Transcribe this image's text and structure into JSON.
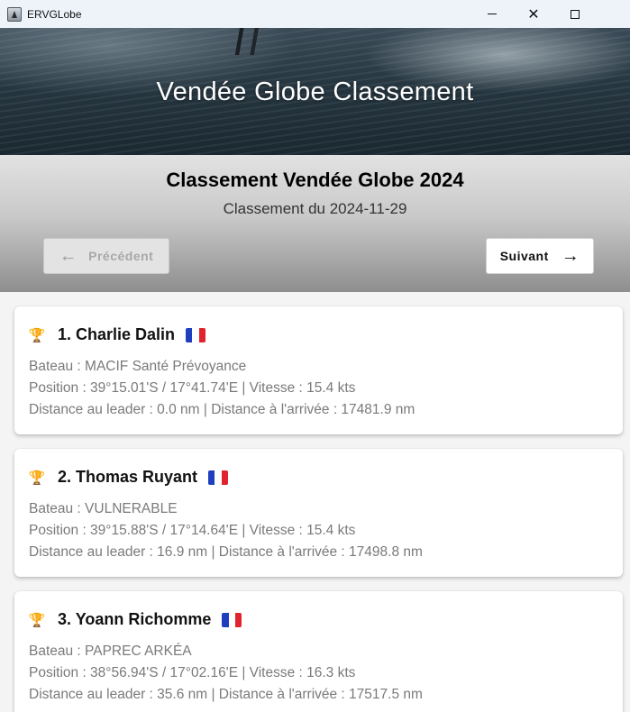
{
  "window": {
    "title": "ERVGLobe"
  },
  "hero": {
    "title": "Vendée Globe Classement"
  },
  "header": {
    "title": "Classement Vendée Globe 2024",
    "subtitle": "Classement du 2024-11-29",
    "prev_label": "Précédent",
    "next_label": "Suivant"
  },
  "entries": [
    {
      "name": "1. Charlie Dalin",
      "boat": "Bateau : MACIF Santé Prévoyance",
      "position": "Position : 39°15.01'S / 17°41.74'E | Vitesse : 15.4 kts",
      "distance": "Distance au leader : 0.0 nm | Distance à l'arrivée : 17481.9 nm",
      "icon": "trophy-gold-icon"
    },
    {
      "name": "2. Thomas Ruyant",
      "boat": "Bateau : VULNERABLE",
      "position": "Position : 39°15.88'S / 17°14.64'E | Vitesse : 15.4 kts",
      "distance": "Distance au leader : 16.9 nm | Distance à l'arrivée : 17498.8 nm",
      "icon": "trophy-silver-icon"
    },
    {
      "name": "3. Yoann Richomme",
      "boat": "Bateau : PAPREC ARKÉA",
      "position": "Position : 38°56.94'S / 17°02.16'E | Vitesse : 16.3 kts",
      "distance": "Distance au leader : 35.6 nm | Distance à l'arrivée : 17517.5 nm",
      "icon": "trophy-bronze-icon"
    }
  ]
}
